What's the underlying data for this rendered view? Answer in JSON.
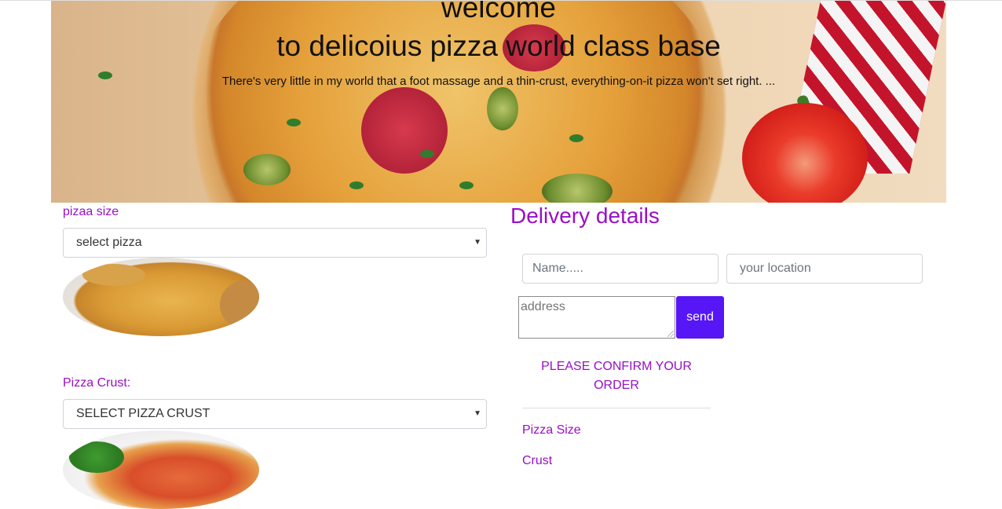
{
  "hero": {
    "title_line1": "welcome",
    "title_line2": "to delicoius pizza world class base",
    "subtitle": "There's very little in my world that a foot massage and a thin-crust, everything-on-it pizza won't set right. ..."
  },
  "order_form": {
    "size_label": "pizaa size",
    "size_select_value": "select pizza",
    "crust_label": "Pizza Crust:",
    "crust_select_value": "SELECT PIZZA CRUST"
  },
  "delivery": {
    "heading": "Delivery details",
    "name_placeholder": "Name.....",
    "location_placeholder": "your location",
    "address_placeholder": "address",
    "send_label": "send",
    "confirm_text": "PLEASE CONFIRM YOUR ORDER",
    "summary": {
      "size_label": "Pizza Size",
      "crust_label": "Crust"
    }
  },
  "colors": {
    "accent_purple": "#9a0fc4",
    "send_button": "#5716f5"
  },
  "icons": {
    "select_caret": "caret-down-icon"
  }
}
